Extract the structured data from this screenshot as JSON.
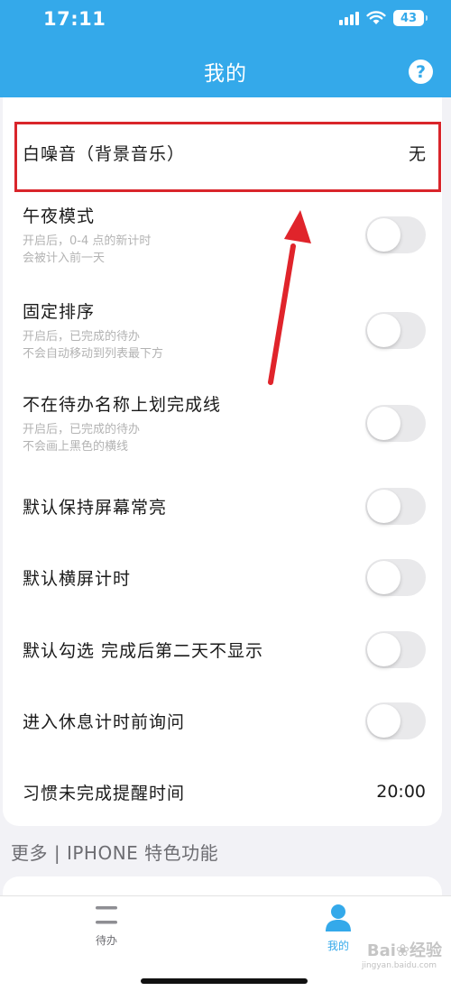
{
  "status_bar": {
    "time": "17:11",
    "battery": "43"
  },
  "nav": {
    "title": "我的",
    "help_label": "?"
  },
  "settings": [
    {
      "title": "白噪音（背景音乐）",
      "value": "无"
    },
    {
      "title": "午夜模式",
      "desc1": "开启后，0-4 点的新计时",
      "desc2": "会被计入前一天",
      "toggle": false
    },
    {
      "title": "固定排序",
      "desc1": "开启后，已完成的待办",
      "desc2": "不会自动移动到列表最下方",
      "toggle": false
    },
    {
      "title": "不在待办名称上划完成线",
      "desc1": "开启后，已完成的待办",
      "desc2": "不会画上黑色的横线",
      "toggle": false
    },
    {
      "title": "默认保持屏幕常亮",
      "toggle": false
    },
    {
      "title": "默认横屏计时",
      "toggle": false
    },
    {
      "title": "默认勾选 完成后第二天不显示",
      "toggle": false
    },
    {
      "title": "进入休息计时前询问",
      "toggle": false
    },
    {
      "title": "习惯未完成提醒时间",
      "value": "20:00"
    }
  ],
  "section_header": "更多 | IPHONE 特色功能",
  "tabs": [
    {
      "label": "待办",
      "icon": "list-icon",
      "active": false
    },
    {
      "label": "我的",
      "icon": "person-icon",
      "active": true
    }
  ],
  "watermark": {
    "main": "Bai❀经验",
    "sub": "jingyan.baidu.com"
  },
  "colors": {
    "accent": "#34a9ea",
    "highlight": "#d9252b",
    "toggle_off": "#e9e9eb",
    "tab_inactive": "#8e8e93"
  }
}
